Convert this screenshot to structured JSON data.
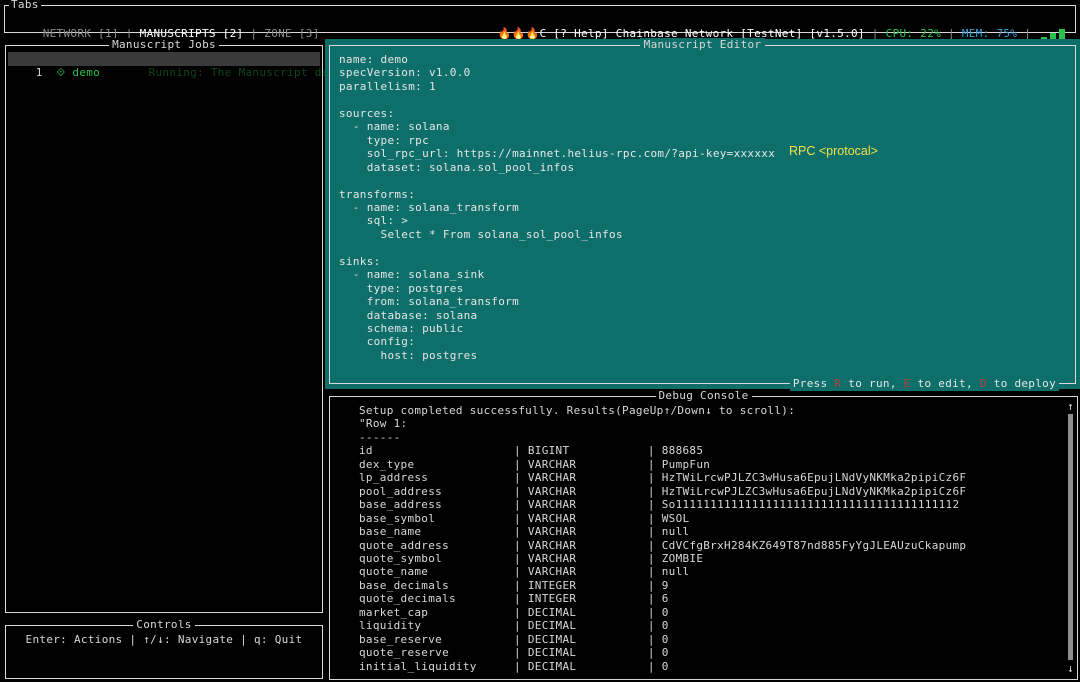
{
  "tabs_title": "Tabs",
  "tabs": [
    {
      "label": "NETWORK [1]",
      "active": false
    },
    {
      "label": "MANUSCRIPTS [2]",
      "active": true
    },
    {
      "label": "ZONE [3]",
      "active": false
    }
  ],
  "status": {
    "flames": "🔥🔥🔥",
    "app": "C [? Help] Chainbase Network [TestNet] [v1.5.0]",
    "cpu": "CPU: 22%",
    "mem": "MEM: 75%",
    "meter_levels": [
      0.3,
      0.6,
      1.0
    ]
  },
  "jobs": {
    "title": "Manuscript Jobs",
    "items": [
      {
        "index": "1",
        "icon": "⟐",
        "name": "demo",
        "status": "Running: The Manuscript demo"
      }
    ]
  },
  "controls": {
    "title": "Controls",
    "text": "Enter: Actions | ↑/↓: Navigate | q: Quit"
  },
  "editor": {
    "title": "Manuscript Editor",
    "lines": [
      "name: demo",
      "specVersion: v1.0.0",
      "parallelism: 1",
      "",
      "sources:",
      "  - name: solana",
      "    type: rpc",
      "    sol_rpc_url: https://mainnet.helius-rpc.com/?api-key=xxxxxx",
      "    dataset: solana.sol_pool_infos",
      "",
      "transforms:",
      "  - name: solana_transform",
      "    sql: >",
      "      Select * From solana_sol_pool_infos",
      "",
      "sinks:",
      "  - name: solana_sink",
      "    type: postgres",
      "    from: solana_transform",
      "    database: solana",
      "    schema: public",
      "    config:",
      "      host: postgres"
    ],
    "annotation": "RPC  <protocal>",
    "hint": {
      "p1": "Press ",
      "k1": "R",
      "p2": " to run, ",
      "k2": "E",
      "p3": " to edit, ",
      "k3": "D",
      "p4": " to deploy"
    }
  },
  "debug": {
    "title": "Debug Console",
    "header": [
      "Setup completed successfully. Results(PageUp↑/Down↓ to scroll):",
      "\"Row 1:",
      "------"
    ],
    "rows": [
      {
        "name": "id",
        "type": "BIGINT",
        "value": "888685"
      },
      {
        "name": "dex_type",
        "type": "VARCHAR",
        "value": "PumpFun"
      },
      {
        "name": "lp_address",
        "type": "VARCHAR",
        "value": "HzTWiLrcwPJLZC3wHusa6EpujLNdVyNKMka2pipiCz6F"
      },
      {
        "name": "pool_address",
        "type": "VARCHAR",
        "value": "HzTWiLrcwPJLZC3wHusa6EpujLNdVyNKMka2pipiCz6F"
      },
      {
        "name": "base_address",
        "type": "VARCHAR",
        "value": "So11111111111111111111111111111111111111112"
      },
      {
        "name": "base_symbol",
        "type": "VARCHAR",
        "value": "WSOL"
      },
      {
        "name": "base_name",
        "type": "VARCHAR",
        "value": "null"
      },
      {
        "name": "quote_address",
        "type": "VARCHAR",
        "value": "CdVCfgBrxH284KZ649T87nd885FyYgJLEAUzuCkapump"
      },
      {
        "name": "quote_symbol",
        "type": "VARCHAR",
        "value": "ZOMBIE"
      },
      {
        "name": "quote_name",
        "type": "VARCHAR",
        "value": "null"
      },
      {
        "name": "base_decimals",
        "type": "INTEGER",
        "value": "9"
      },
      {
        "name": "quote_decimals",
        "type": "INTEGER",
        "value": "6"
      },
      {
        "name": "market_cap",
        "type": "DECIMAL",
        "value": "0"
      },
      {
        "name": "liquidity",
        "type": "DECIMAL",
        "value": "0"
      },
      {
        "name": "base_reserve",
        "type": "DECIMAL",
        "value": "0"
      },
      {
        "name": "quote_reserve",
        "type": "DECIMAL",
        "value": "0"
      },
      {
        "name": "initial_liquidity",
        "type": "DECIMAL",
        "value": "0"
      }
    ],
    "scroll_up": "↑",
    "scroll_down": "↓"
  }
}
